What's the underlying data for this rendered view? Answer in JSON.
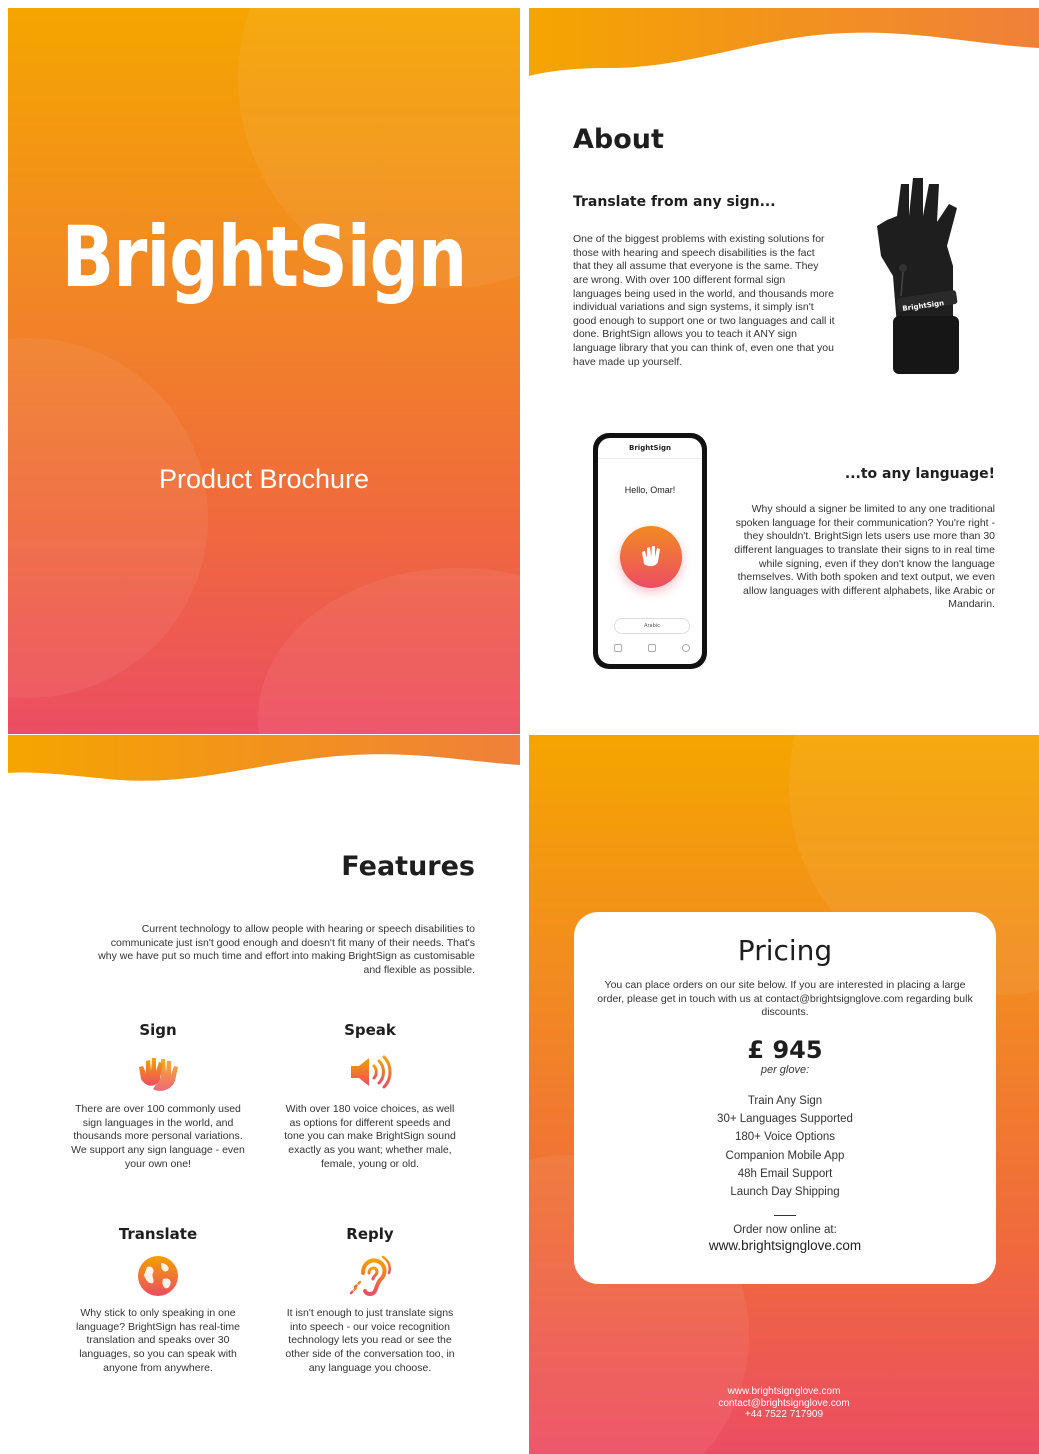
{
  "cover": {
    "title": "BrightSign",
    "subtitle": "Product Brochure"
  },
  "about": {
    "heading": "About",
    "section1_title": "Translate from any sign...",
    "section1_text": "One of the biggest problems with existing solutions for those with hearing and speech disabilities is the fact that they all assume that everyone is the same. They are wrong. With over 100 different formal sign languages being used in the world, and thousands more individual variations and sign systems, it simply isn't good enough to support one or two languages and call it done. BrightSign allows you to teach it ANY sign language library that you can think of, even one that you have made up yourself.",
    "glove_label": "BrightSign",
    "phone": {
      "brand": "BrightSign",
      "greeting": "Hello, Omar!",
      "selected_language": "Arabic"
    },
    "section2_title": "...to any language!",
    "section2_text": "Why should a signer be limited to any one traditional spoken language for their communication? You're right - they shouldn't. BrightSign lets users use more than 30 different languages to translate their signs to in real time while signing, even if they don't know the language themselves. With both spoken and text output, we even allow languages with different alphabets, like Arabic or Mandarin."
  },
  "features": {
    "heading": "Features",
    "intro": "Current technology to allow people with hearing or speech disabilities to communicate just isn't good enough and doesn't fit many of their needs. That's why we have put so much time and effort into making BrightSign as customisable and flexible as possible.",
    "items": [
      {
        "title": "Sign",
        "icon": "sign-hands-icon",
        "text": "There are over 100 commonly used sign languages in the world, and thousands more personal variations. We support any sign language - even your own one!"
      },
      {
        "title": "Speak",
        "icon": "speaker-icon",
        "text": "With over 180 voice choices, as well as options for different speeds and tone you can make BrightSign sound exactly as you want; whether male, female, young or old."
      },
      {
        "title": "Translate",
        "icon": "globe-icon",
        "text": "Why stick to only speaking in one language? BrightSign has real-time translation and speaks over 30 languages, so you can speak with anyone from anywhere."
      },
      {
        "title": "Reply",
        "icon": "ear-icon",
        "text": "It isn't enough to just translate signs into speech - our voice recognition technology lets you read or see the other side of the conversation too, in any language you choose."
      }
    ]
  },
  "pricing": {
    "heading": "Pricing",
    "intro": "You can place orders on our site below. If you are interested in placing a large order, please get in touch with us at contact@brightsignglove.com regarding bulk discounts.",
    "price": "£ 945",
    "per": "per glove:",
    "features": [
      "Train Any Sign",
      "30+ Languages Supported",
      "180+ Voice Options",
      "Companion Mobile App",
      "48h Email Support",
      "Launch Day Shipping"
    ],
    "order_label": "Order now online at:",
    "order_url": "www.brightsignglove.com",
    "footer": {
      "website": "www.brightsignglove.com",
      "email": "contact@brightsignglove.com",
      "phone": "+44 7522 717909"
    }
  },
  "colors": {
    "gradient_top": "#f5a500",
    "gradient_mid": "#f28a22",
    "gradient_bottom": "#ec4d63"
  }
}
